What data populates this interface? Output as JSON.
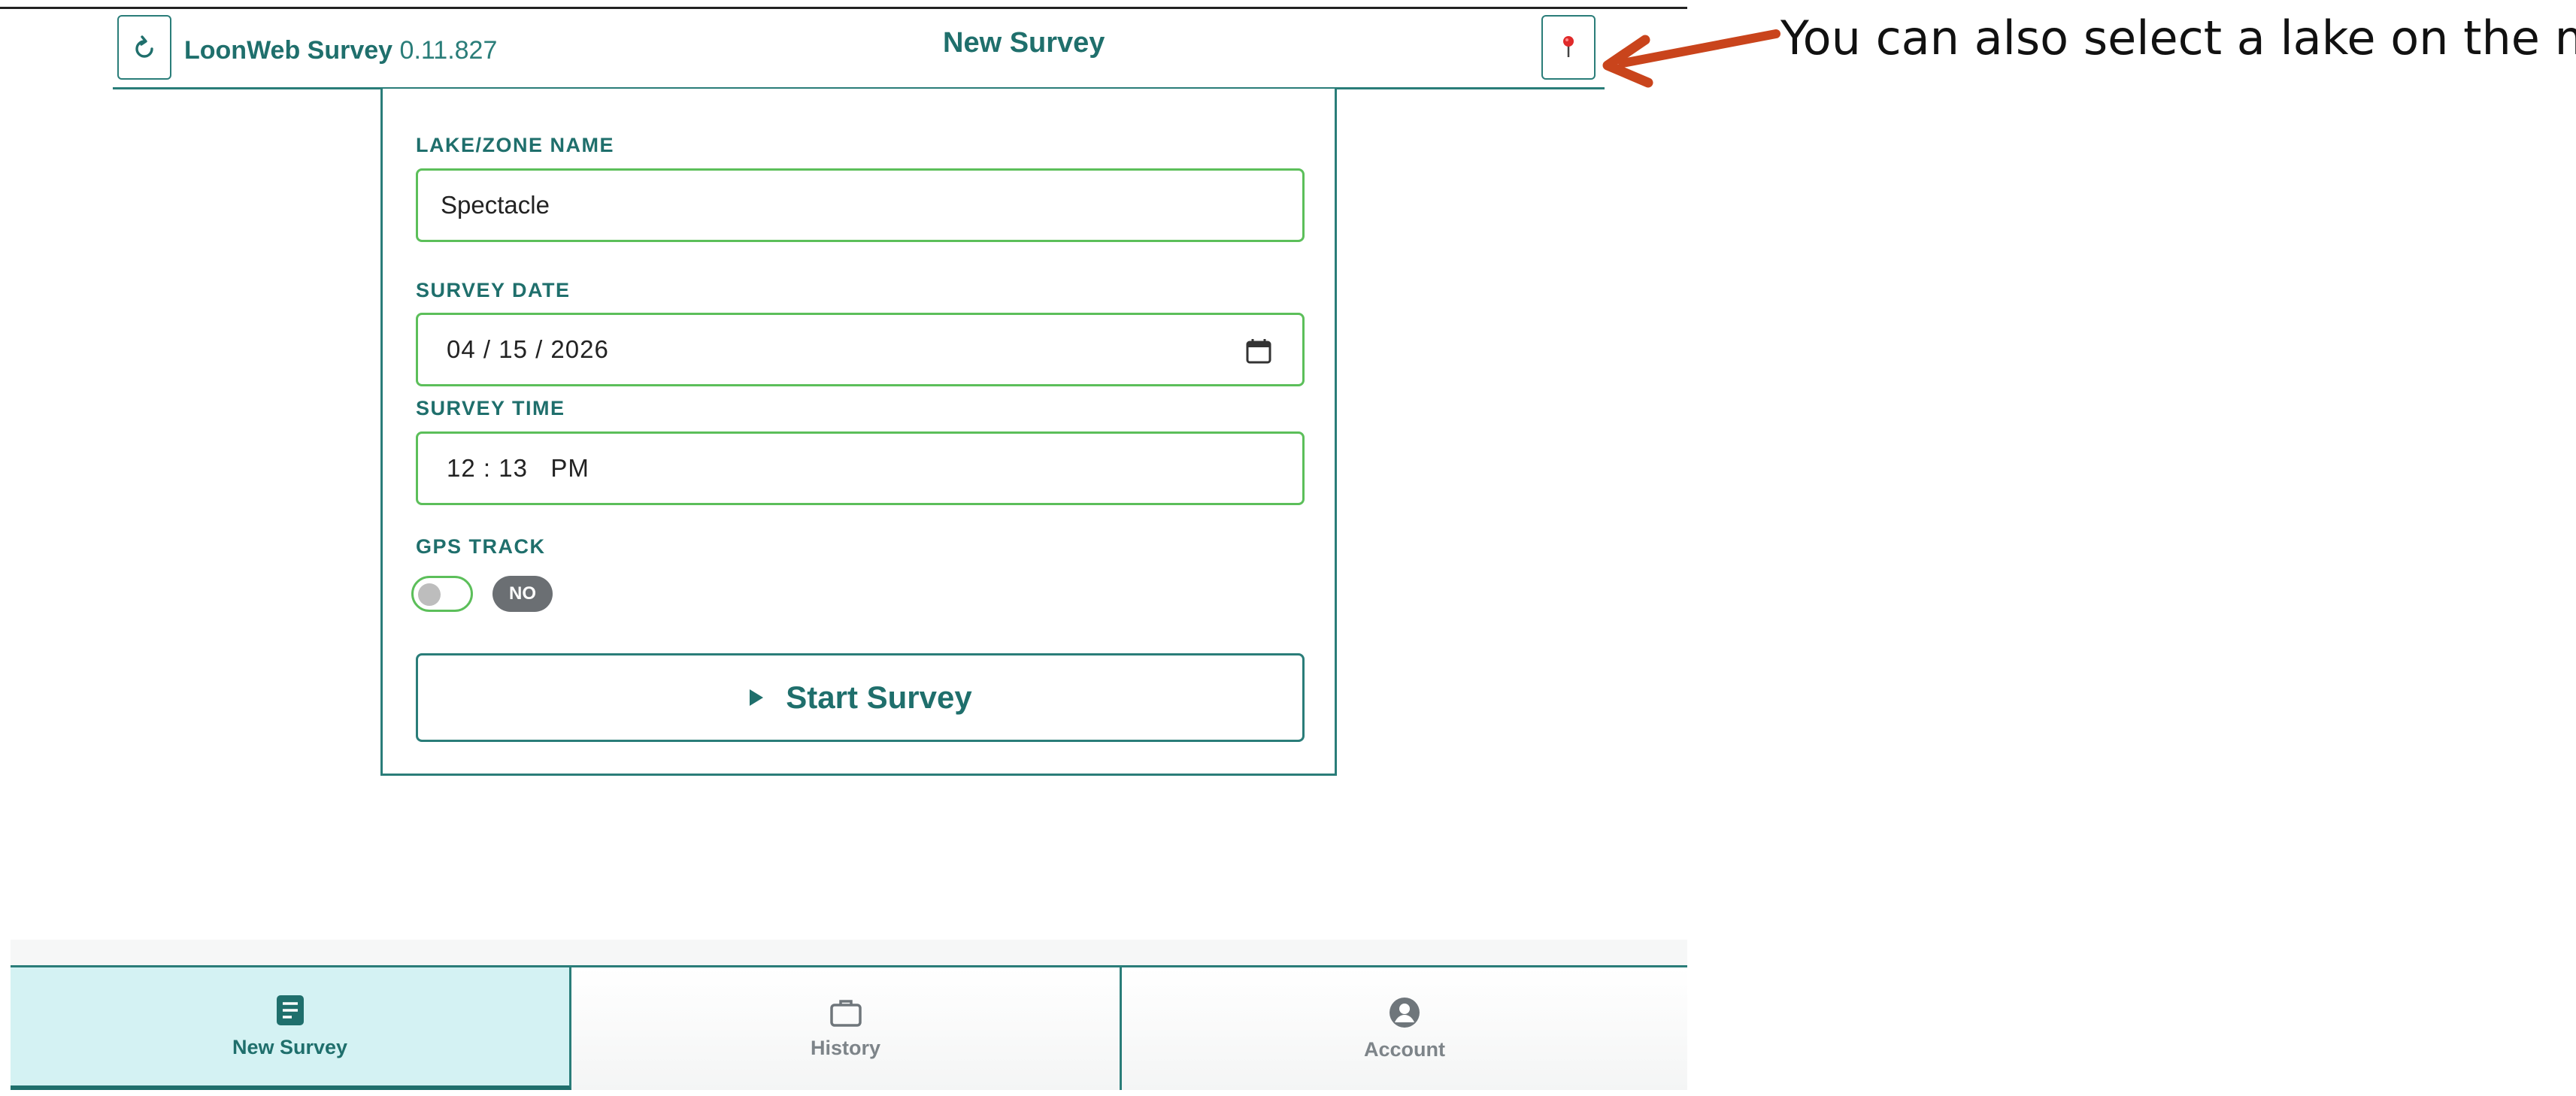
{
  "header": {
    "app_name": "LoonWeb Survey",
    "version": "0.11.827",
    "title": "New Survey",
    "refresh_icon": "refresh-icon",
    "map_icon": "map-pin-icon"
  },
  "annotation": {
    "text": "You can also select a lake on the map",
    "arrow_color": "#c9441c"
  },
  "form": {
    "lake_label": "LAKE/ZONE NAME",
    "lake_value": "Spectacle",
    "date_label": "SURVEY DATE",
    "date_value": "04 / 15 / 2026",
    "time_label": "SURVEY TIME",
    "time_value": "12 : 13   PM",
    "gps_label": "GPS TRACK",
    "gps_state": "NO",
    "start_label": "Start Survey"
  },
  "tabs": [
    {
      "label": "New Survey",
      "icon": "document-icon",
      "active": true
    },
    {
      "label": "History",
      "icon": "briefcase-icon",
      "active": false
    },
    {
      "label": "Account",
      "icon": "account-icon",
      "active": false
    }
  ],
  "colors": {
    "primary": "#1f6f6c",
    "field_border": "#5cbf5a",
    "active_tab_bg": "#d4f2f3",
    "badge_bg": "#6b6f73"
  }
}
